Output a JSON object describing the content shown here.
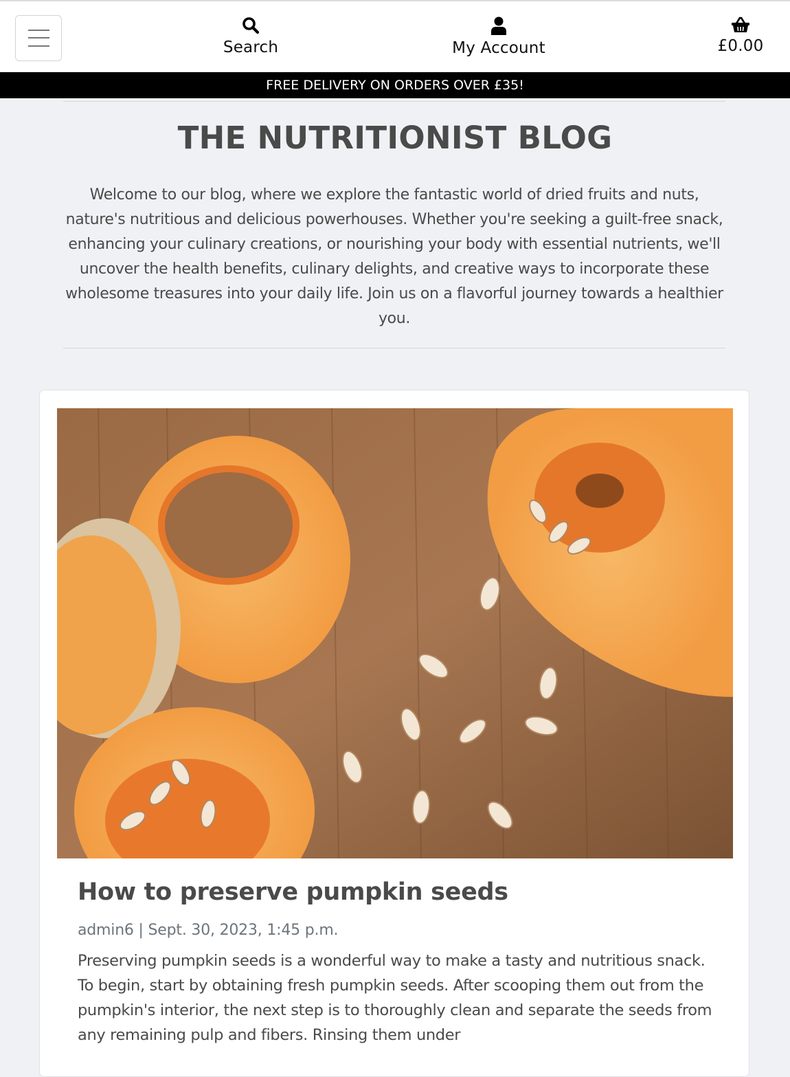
{
  "nav": {
    "menu_icon": "hamburger-menu-icon",
    "search": {
      "label": "Search",
      "icon": "search-icon"
    },
    "account": {
      "label": "My Account",
      "icon": "user-icon"
    },
    "basket": {
      "label": "£0.00",
      "icon": "basket-icon"
    }
  },
  "banner": {
    "text": "FREE DELIVERY ON ORDERS OVER £35!"
  },
  "blog": {
    "title": "THE NUTRITIONIST BLOG",
    "intro": "Welcome to our blog, where we explore the fantastic world of dried fruits and nuts, nature's nutritious and delicious powerhouses. Whether you're seeking a guilt-free snack, enhancing your culinary creations, or nourishing your body with essential nutrients, we'll uncover the health benefits, culinary delights, and creative ways to incorporate these wholesome treasures into your daily life. Join us on a flavorful journey towards a healthier you."
  },
  "posts": [
    {
      "title": "How to preserve pumpkin seeds",
      "meta": "admin6 | Sept. 30, 2023, 1:45 p.m.",
      "excerpt": "Preserving pumpkin seeds is a wonderful way to make a tasty and nutritious snack. To begin, start by obtaining fresh pumpkin seeds. After scooping them out from the pumpkin's interior, the next step is to thoroughly clean and separate the seeds from any remaining pulp and fibers. Rinsing them under"
    }
  ],
  "colors": {
    "page_bg": "#f0f1f5",
    "banner_bg": "#000000",
    "heading": "#4a4a4a",
    "meta": "#6c757d",
    "card_bg": "#ffffff"
  }
}
